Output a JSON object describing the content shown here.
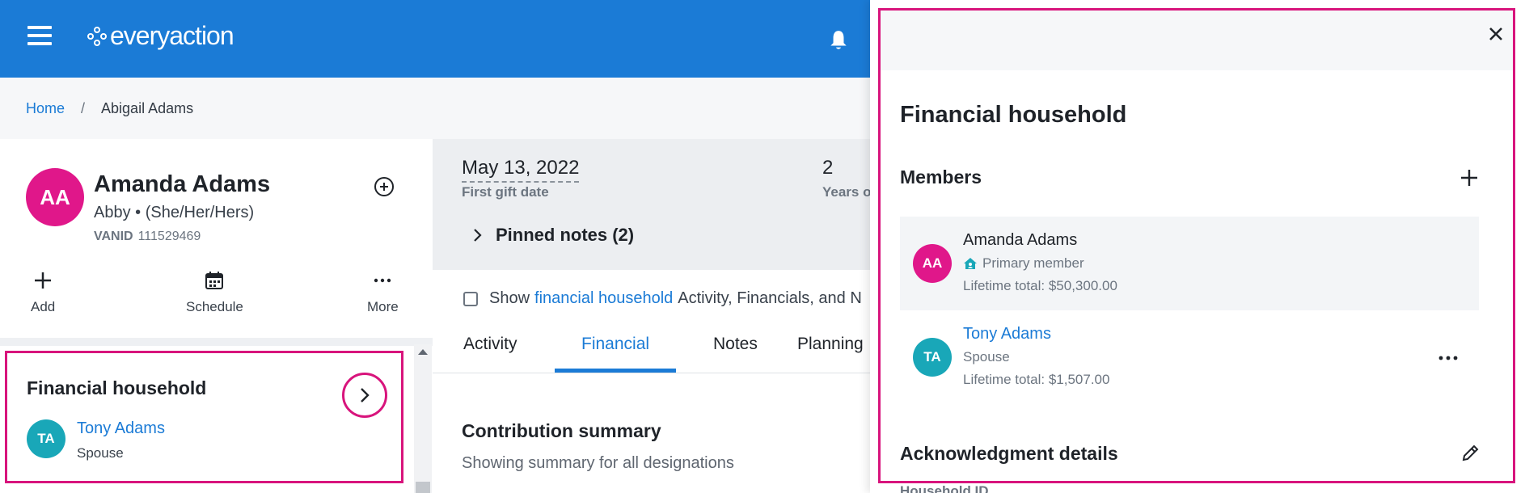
{
  "header": {
    "brand": "everyaction"
  },
  "breadcrumb": {
    "home": "Home",
    "separator": "/",
    "current": "Abigail Adams"
  },
  "profile": {
    "initials": "AA",
    "name": "Amanda Adams",
    "subtitle": "Abby • (She/Her/Hers)",
    "vanid_label": "VANID",
    "vanid_value": "111529469",
    "avatar_color": "#e0178a"
  },
  "quick_actions": [
    {
      "label": "Add",
      "icon": "plus-icon"
    },
    {
      "label": "Schedule",
      "icon": "calendar-icon"
    },
    {
      "label": "More",
      "icon": "more-dots-icon"
    }
  ],
  "financial_household_card": {
    "title": "Financial household",
    "member_initials": "TA",
    "member_name": "Tony Adams",
    "member_relation": "Spouse"
  },
  "summary": {
    "first_gift_date": "May 13, 2022",
    "first_gift_label": "First gift date",
    "years_value": "2",
    "years_label": "Years o",
    "pinned_notes": "Pinned notes (2)"
  },
  "show_household": {
    "prefix": "Show",
    "link": "financial household",
    "suffix": "Activity, Financials, and N",
    "checked": false
  },
  "tabs": [
    {
      "label": "Activity",
      "active": false
    },
    {
      "label": "Financial",
      "active": true
    },
    {
      "label": "Notes",
      "active": false
    },
    {
      "label": "Planning",
      "active": false
    }
  ],
  "contribution": {
    "title": "Contribution summary",
    "subtitle": "Showing summary for all designations"
  },
  "drawer": {
    "title": "Financial household",
    "members_label": "Members",
    "members": [
      {
        "initials": "AA",
        "name": "Amanda Adams",
        "role": "Primary member",
        "lifetime": "Lifetime total: $50,300.00",
        "avatar_color": "#e0178a"
      },
      {
        "initials": "TA",
        "name": "Tony Adams",
        "role": "Spouse",
        "lifetime": "Lifetime total: $1,507.00",
        "avatar_color": "#19a7b8"
      }
    ],
    "ack_label": "Acknowledgment details",
    "household_id_label": "Household ID"
  },
  "colors": {
    "brand_blue": "#1b7bd6",
    "highlight_pink": "#d8147c",
    "teal_avatar": "#19a7b8"
  }
}
